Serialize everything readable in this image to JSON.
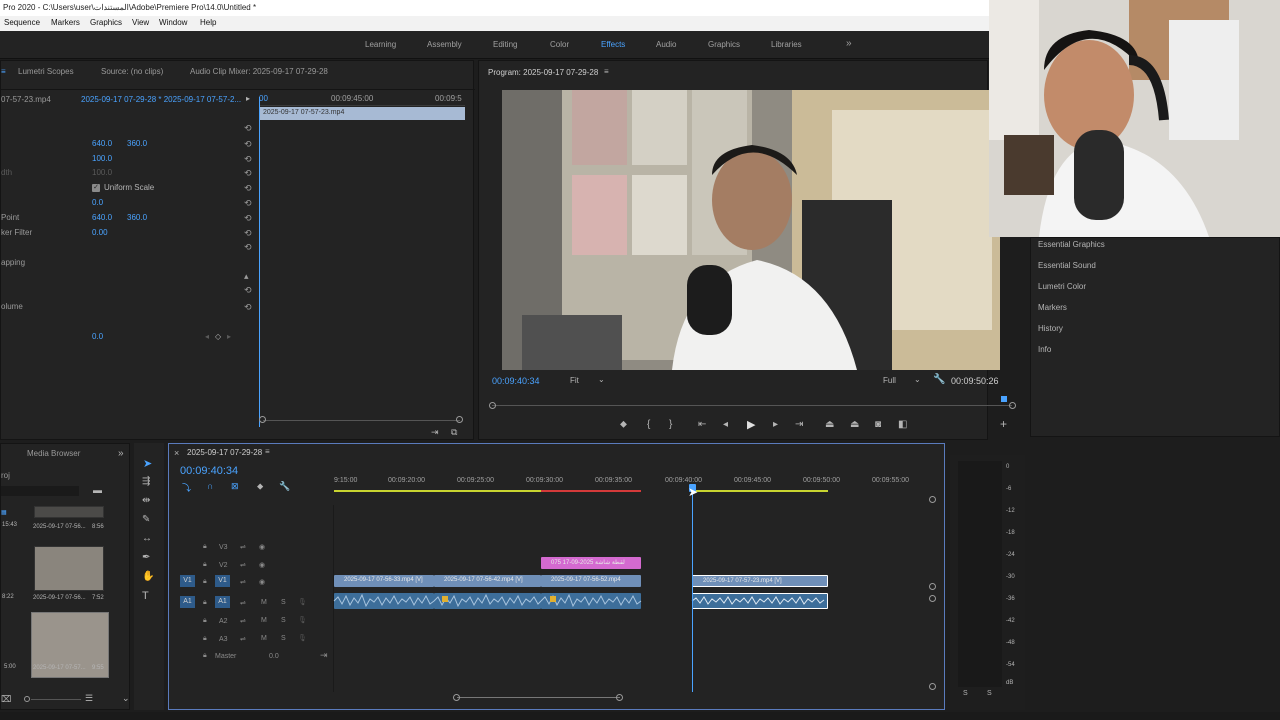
{
  "titlebar": {
    "text": "Pro 2020 - C:\\Users\\user\\المستندات\\Adobe\\Premiere Pro\\14.0\\Untitled *"
  },
  "menu": [
    "Sequence",
    "Markers",
    "Graphics",
    "View",
    "Window",
    "Help"
  ],
  "workspaces": {
    "items": [
      "Learning",
      "Assembly",
      "Editing",
      "Color",
      "Effects",
      "Audio",
      "Graphics",
      "Libraries"
    ],
    "active": "Effects",
    "more": "»"
  },
  "source_panel": {
    "tabs": [
      "Lumetri Scopes",
      "Source: (no clips)",
      "Audio Clip Mixer: 2025-09-17 07-29-28"
    ],
    "clip_path_left": "07-57-23.mp4",
    "clip_path_right": "2025-09-17 07-29-28 * 2025-09-17 07-57-2...",
    "ruler_start": "00",
    "ruler_mid": "00:09:45:00",
    "ruler_end": "00:09:5",
    "clip_label": "2025-09-17 07-57-23.mp4",
    "rows": [
      {
        "label": "",
        "v1": "640.0",
        "v2": "360.0"
      },
      {
        "label": "",
        "v1": "100.0",
        "v2": ""
      },
      {
        "label": "dth",
        "v1": "100.0",
        "v2": ""
      },
      {
        "label": "",
        "v1": "Uniform Scale",
        "v2": ""
      },
      {
        "label": "",
        "v1": "0.0",
        "v2": ""
      },
      {
        "label": "Point",
        "v1": "640.0",
        "v2": "360.0"
      },
      {
        "label": "ker Filter",
        "v1": "0.00",
        "v2": ""
      },
      {
        "label": "apping",
        "v1": "",
        "v2": ""
      },
      {
        "label": "olume",
        "v1": "",
        "v2": ""
      }
    ],
    "volume_value": "0.0",
    "volume_key": "◇"
  },
  "program_monitor": {
    "title": "Program: 2025-09-17 07-29-28",
    "timecode_current": "00:09:40:34",
    "fit": "Fit",
    "quality": "Full",
    "timecode_total": "00:09:50:26"
  },
  "right_panels": [
    "Essential Graphics",
    "Essential Sound",
    "Lumetri Color",
    "Markers",
    "History",
    "Info"
  ],
  "project_panel": {
    "tab": "Media Browser",
    "proj_label": "roj",
    "items": [
      {
        "name": "2025-09-17 07-56...",
        "dur": "8:56",
        "left_dur": "15:43"
      },
      {
        "name": "2025-09-17 07-56...",
        "dur": "7:52",
        "left_dur": "8:22"
      },
      {
        "name": "2025-09-17 07-57...",
        "dur": "9:55",
        "left_dur": "5:00"
      }
    ]
  },
  "timeline": {
    "title": "2025-09-17 07-29-28",
    "timecode": "00:09:40:34",
    "ruler": [
      "9:15:00",
      "00:09:20:00",
      "00:09:25:00",
      "00:09:30:00",
      "00:09:35:00",
      "00:09:40:00",
      "00:09:45:00",
      "00:09:50:00",
      "00:09:55:00"
    ],
    "tracks": {
      "v3": "V3",
      "v2": "V2",
      "v1": "V1",
      "v1_src": "V1",
      "a1": "A1",
      "a1_src": "A1",
      "a2": "A2",
      "a3": "A3",
      "master": "Master",
      "master_val": "0.0"
    },
    "clips": {
      "v1_a": "2025-09-17 07-56-33.mp4 [V]",
      "v1_b": "2025-09-17 07-56-42.mp4 [V]",
      "v1_c": "2025-09-17 07-56-52.mp4",
      "v1_d": "2025-09-17 07-57-23.mp4 [V]",
      "v2_graphic": "075 17-09-2025 لقطة شاشة"
    },
    "meter_scale": [
      "0",
      "-6",
      "-12",
      "-18",
      "-24",
      "-30",
      "-36",
      "-42",
      "-48",
      "-54",
      "dB"
    ],
    "meter_solo": [
      "S",
      "S"
    ]
  },
  "colors": {
    "accent": "#4aa3ff",
    "video_clip": "#6f8fb8",
    "audio_clip": "#3d6e9a",
    "graphic_clip": "#d46ad0",
    "selection": "#5a7bbd"
  }
}
